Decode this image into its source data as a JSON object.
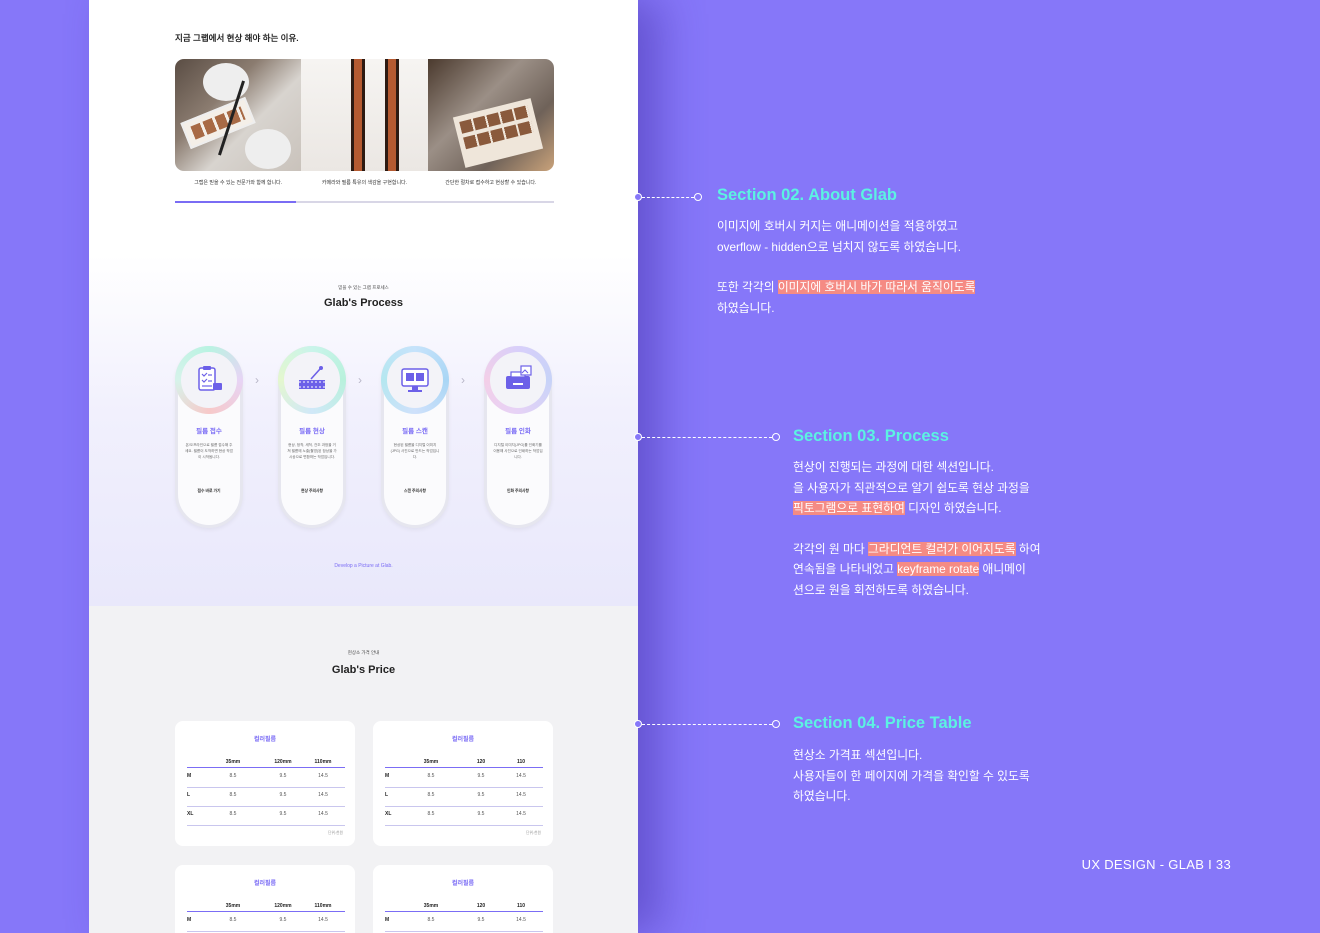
{
  "about": {
    "title": "지금 그랩에서 현상 해야 하는 이유.",
    "captions": [
      "그랩은 믿을 수 있는 전문가와 함께 합니다.",
      "카메라와 필름 특유의 색감을 구현합니다.",
      "간단한 절차로 접수하고 현상할 수 있습니다."
    ],
    "slider_progress": 0.32
  },
  "process": {
    "eyebrow": "믿을 수 있는 그랩 프로세스",
    "heading": "Glab's Process",
    "steps": [
      {
        "title": "필름 접수",
        "desc": "온/오프라인으로 필름 접수해 주세요. 필름이 도착하면 현상 작업이 시작됩니다.",
        "link": "접수 바로 가기",
        "icon": "clipboard-camera-icon"
      },
      {
        "title": "필름 현상",
        "desc": "현상, 정착, 세척, 건조 과정을 거쳐 필름에 노출(촬영)된 잠상을 가시상으로 변환하는 작업입니다.",
        "link": "현상 주의사항",
        "icon": "film-develop-icon"
      },
      {
        "title": "필름 스캔",
        "desc": "현상된 필름을 디지털 이미지(JPG) 사진으로 만드는 작업입니다.",
        "link": "스캔 주의사항",
        "icon": "monitor-scan-icon"
      },
      {
        "title": "필름 인화",
        "desc": "디지털 이미지(JPG)를 인화기를 이용해 사진으로 인쇄하는 작업입니다.",
        "link": "인화 주의사항",
        "icon": "printer-photo-icon"
      }
    ],
    "footer": "Develop a Picture at Glab."
  },
  "price": {
    "eyebrow": "현상소 가격 안내",
    "heading": "Glab's Price",
    "tables": [
      {
        "name": "컬러필름",
        "cols": [
          "35mm",
          "120mm",
          "110mm"
        ],
        "rows": [
          [
            "M",
            "8.5",
            "9.5",
            "14.5"
          ],
          [
            "L",
            "8.5",
            "9.5",
            "14.5"
          ],
          [
            "XL",
            "8.5",
            "9.5",
            "14.5"
          ]
        ],
        "note": "단위:천원"
      },
      {
        "name": "컬러필름",
        "cols": [
          "35mm",
          "120",
          "110"
        ],
        "rows": [
          [
            "M",
            "8.5",
            "9.5",
            "14.5"
          ],
          [
            "L",
            "8.5",
            "9.5",
            "14.5"
          ],
          [
            "XL",
            "8.5",
            "9.5",
            "14.5"
          ]
        ],
        "note": "단위:천원"
      },
      {
        "name": "컬러필름",
        "cols": [
          "35mm",
          "120mm",
          "110mm"
        ],
        "rows": [
          [
            "M",
            "8.5",
            "9.5",
            "14.5"
          ]
        ],
        "note": ""
      },
      {
        "name": "컬러필름",
        "cols": [
          "35mm",
          "120",
          "110"
        ],
        "rows": [
          [
            "M",
            "8.5",
            "9.5",
            "14.5"
          ]
        ],
        "note": ""
      }
    ]
  },
  "notes": {
    "s2": {
      "title": "Section 02. About Glab",
      "line1": "이미지에 호버시 커지는 애니메이션을 적용하였고",
      "line2": "overflow - hidden으로 넘치지 않도록 하였습니다.",
      "line3_a": "또한 각각의 ",
      "line3_hl": "이미지에 호버시 바가 따라서 움직이도록",
      "line4": "하였습니다."
    },
    "s3": {
      "title": "Section 03. Process",
      "line1": "현상이 진행되는 과정에 대한 섹션입니다.",
      "line2": "을 사용자가 직관적으로 알기 쉽도록 현상 과정을",
      "line3_hl": "픽토그램으로 표현하여",
      "line3_b": " 디자인 하였습니다.",
      "line4_a": "각각의 원 마다 ",
      "line4_hl": "그라디언트 컬러가 이어지도록",
      "line4_b": " 하여",
      "line5_a": "연속됨을 나타내었고 ",
      "line5_hl": "keyframe rotate",
      "line5_b": " 애니메이",
      "line6": "션으로 원을 회전하도록 하였습니다."
    },
    "s4": {
      "title": "Section 04. Price Table",
      "line1": "현상소 가격표 섹션입니다.",
      "line2": "사용자들이 한 페이지에 가격을 확인할 수 있도록",
      "line3": "하였습니다."
    }
  },
  "footer_label": "UX DESIGN - GLAB I 33",
  "colors": {
    "background": "#8677f9",
    "accent": "#7b6df5",
    "title_mint": "#5cf2e2",
    "highlight": "#f58b84"
  }
}
